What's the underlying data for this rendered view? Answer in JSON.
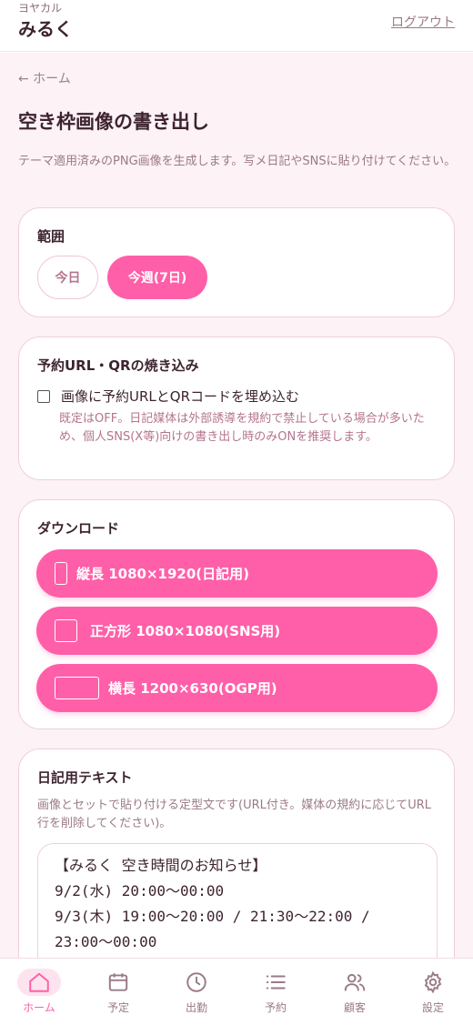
{
  "header": {
    "shop_kana": "ヨヤカル",
    "app_name": "みるく",
    "logout_label": "ログアウト"
  },
  "breadcrumb": {
    "back_label": "← ホーム"
  },
  "page": {
    "title": "空き枠画像の書き出し",
    "lead": "テーマ適用済みのPNG画像を生成します。写メ日記やSNSに貼り付けてください。"
  },
  "range": {
    "title": "範囲",
    "options": [
      "今日",
      "今週(7日)"
    ],
    "selected": "今週(7日)"
  },
  "embed": {
    "title": "予約URL・QRの焼き込み",
    "checkbox_label": "画像に予約URLとQRコードを埋め込む",
    "checked": false,
    "note": "既定はOFF。日記媒体は外部誘導を規約で禁止している場合が多いため、個人SNS(X等)向けの書き出し時のみONを推奨します。"
  },
  "download": {
    "title": "ダウンロード",
    "buttons": [
      {
        "label": "縦長 1080×1920(日記用)",
        "icon": "portrait-frame-icon"
      },
      {
        "label": "正方形 1080×1080(SNS用)",
        "icon": "square-frame-icon"
      },
      {
        "label": "横長 1200×630(OGP用)",
        "icon": "landscape-frame-icon"
      }
    ]
  },
  "diary": {
    "title": "日記用テキスト",
    "description": "画像とセットで貼り付ける定型文です(URL付き。媒体の規約に応じてURL行を削除してください)。",
    "lines": [
      "【みるく 空き時間のお知らせ】",
      "9/2(水) 20:00〜00:00",
      "9/3(木) 19:00〜20:00 / 21:30〜22:00 /",
      "23:00〜00:00"
    ]
  },
  "nav": {
    "items": [
      {
        "label": "ホーム",
        "icon": "home-icon",
        "active": true
      },
      {
        "label": "予定",
        "icon": "calendar-icon",
        "active": false
      },
      {
        "label": "出勤",
        "icon": "clock-icon",
        "active": false
      },
      {
        "label": "予約",
        "icon": "list-icon",
        "active": false
      },
      {
        "label": "顧客",
        "icon": "users-icon",
        "active": false
      },
      {
        "label": "設定",
        "icon": "gear-icon",
        "active": false
      }
    ]
  },
  "colors": {
    "accent": "#ff5fa8",
    "background": "#fdf2f6",
    "text": "#3d2430",
    "muted": "#9a7a88"
  }
}
